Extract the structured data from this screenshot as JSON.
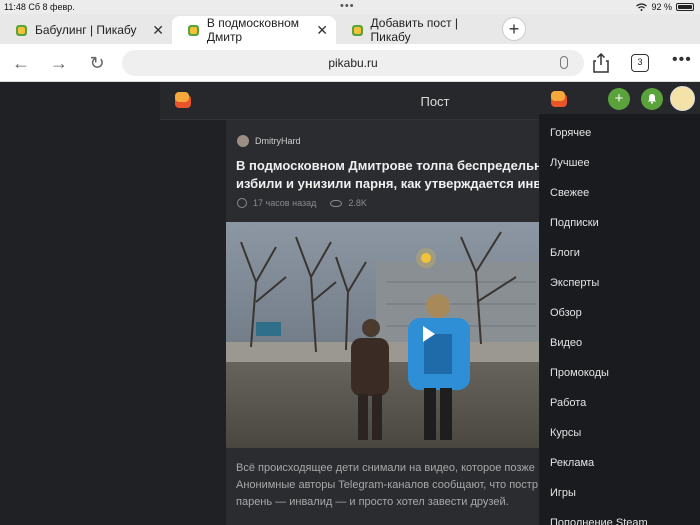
{
  "status": {
    "time": "11:48",
    "date": "Сб 8 февр.",
    "battery": "92 %"
  },
  "tabs": [
    {
      "label": "Бабулинг | Пикабу"
    },
    {
      "label": "В подмосковном Дмитр"
    },
    {
      "label": "Добавить пост | Пикабу"
    }
  ],
  "browser": {
    "url": "pikabu.ru",
    "tab_count": "3"
  },
  "site": {
    "header_title": "Пост"
  },
  "post": {
    "author": "DmitryHard",
    "title_line1": "В подмосковном Дмитрове толпа беспредельных д",
    "title_line2": "избили и унизили парня, как утверждается инвалид",
    "time_ago": "17 часов назад",
    "views": "2.8K",
    "body_line1": "Всё происходящее дети снимали на видео, которое позже",
    "body_line2": "Анонимные авторы Telegram-каналов сообщают, что постр",
    "body_line3": "парень — инвалид — и просто хотел завести друзей."
  },
  "menu": {
    "items": [
      "Горячее",
      "Лучшее",
      "Свежее",
      "Подписки",
      "Блоги",
      "Эксперты",
      "Обзор",
      "Видео",
      "Промокоды",
      "Работа",
      "Курсы",
      "Реклама",
      "Игры",
      "Пополнение Steam"
    ]
  },
  "colors": {
    "accent_green": "#5aa33c",
    "background": "#1f2124",
    "menu_bg": "#1a1b1e"
  }
}
